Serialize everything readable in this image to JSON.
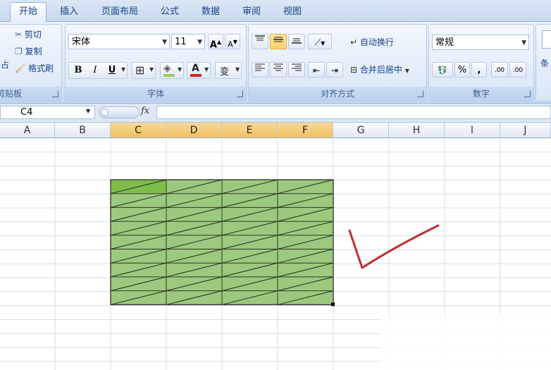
{
  "tabs": [
    {
      "label": "开始",
      "active": true
    },
    {
      "label": "插入",
      "active": false
    },
    {
      "label": "页面布局",
      "active": false
    },
    {
      "label": "公式",
      "active": false
    },
    {
      "label": "数据",
      "active": false
    },
    {
      "label": "审阅",
      "active": false
    },
    {
      "label": "视图",
      "active": false
    }
  ],
  "clipboard": {
    "paste_partial": "占",
    "cut_label": "剪切",
    "copy_label": "复制",
    "format_painter_label": "格式刷",
    "title_partial": "剪贴板"
  },
  "font": {
    "name": "宋体",
    "size": "11",
    "grow_label": "A",
    "shrink_label": "A",
    "bold": "B",
    "italic": "I",
    "underline": "U",
    "font_color_label": "A",
    "phonetic_label": "变",
    "title": "字体"
  },
  "alignment": {
    "wrap_text_label": "自动换行",
    "merge_center_label": "合并后居中",
    "title": "对齐方式"
  },
  "number": {
    "format": "常规",
    "percent": "%",
    "comma": ",",
    "inc_decimal": ".00",
    "dec_decimal": ".00",
    "title": "数字"
  },
  "styles": {
    "partial_label": "条"
  },
  "formula_bar": {
    "name_box": "C4",
    "fx": "fx",
    "value": ""
  },
  "columns": [
    "A",
    "B",
    "C",
    "D",
    "E",
    "F",
    "G",
    "H",
    "I",
    "J"
  ],
  "selected_columns": [
    "C",
    "D",
    "E",
    "F"
  ],
  "colors": {
    "cell_fill": "#9dc97e",
    "active_cell_fill": "#7fbd4a",
    "annotation_stroke": "#c0302e"
  }
}
